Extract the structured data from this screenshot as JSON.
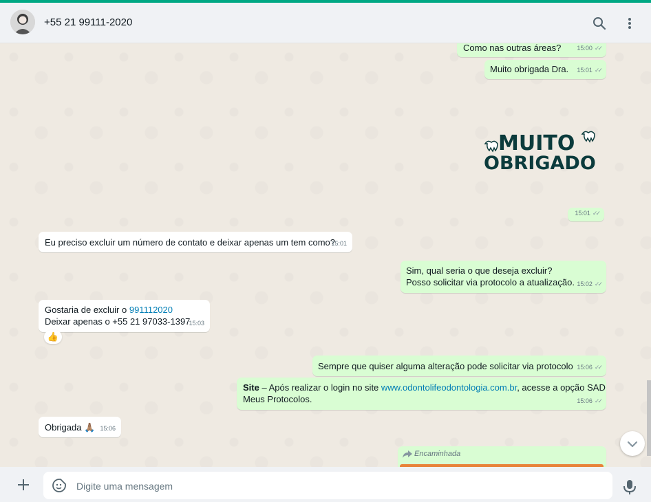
{
  "header": {
    "contact_name": "+55 21 99111-2020"
  },
  "icons": {
    "search": "search-icon",
    "menu": "vertical-dots-icon",
    "attach": "plus-icon",
    "sticker": "sticker-icon",
    "mic": "microphone-icon",
    "scroll_down": "chevron-down-icon",
    "forward": "forward-arrow-icon"
  },
  "messages": {
    "m1": {
      "text": "Como nas outras áreas?",
      "time": "15:00"
    },
    "m2": {
      "text": "Muito obrigada Dra.",
      "time": "15:01"
    },
    "sticker": {
      "line1": "MUITO",
      "line2": "OBRIGADO",
      "time": "15:01"
    },
    "m3": {
      "text": "Eu preciso excluir um número de contato e deixar apenas um tem como?",
      "time": "15:01"
    },
    "m4": {
      "line1": "Sim, qual seria o que deseja excluir?",
      "line2": "Posso solicitar via protocolo a atualização.",
      "time": "15:02"
    },
    "m5": {
      "line1_prefix": "Gostaria de excluir o ",
      "line1_link": "991112020",
      "line2": "Deixar apenas o +55 21 97033-1397",
      "time": "15:03",
      "reaction": "👍"
    },
    "m6": {
      "text": "Sempre que quiser alguma alteração pode solicitar via protocolo",
      "time": "15:06"
    },
    "m7": {
      "bold": "Site",
      "prefix": " – Após realizar o login no site ",
      "link": "www.odontolifeodontologia.com.br",
      "suffix": ", acesse a opção SAD",
      "line2": "Meus Protocolos.",
      "time": "15:06"
    },
    "m8": {
      "text": "Obrigada 🙏🏽",
      "time": "15:06"
    },
    "m9": {
      "forwarded_label": "Encaminhada"
    }
  },
  "composer": {
    "placeholder": "Digite uma mensagem"
  },
  "colors": {
    "accent": "#00a884",
    "outgoing": "#d9fdd3",
    "incoming": "#ffffff",
    "link": "#027eb5",
    "sticker_text": "#0b3b3c"
  }
}
